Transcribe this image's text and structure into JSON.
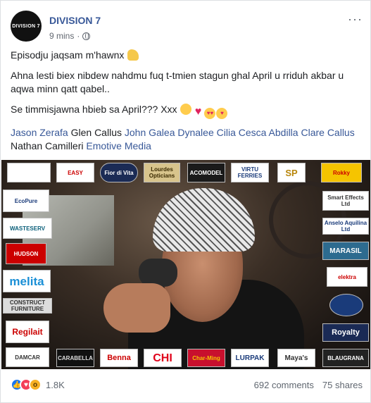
{
  "post": {
    "page_name": "DIVISION 7",
    "avatar_text": "DIVISION 7",
    "time": "9 mins",
    "dot": "·",
    "more": "···",
    "line1": "Episodju jaqsam m'hawnx",
    "line2": "Ahna lesti biex nibdew nahdmu fuq t-tmien stagun ghal April u rriduh akbar u aqwa minn qatt qabel..",
    "line3": "Se timmisjawna hbieb sa April??? Xxx",
    "tags": [
      {
        "text": "Jason Zerafa",
        "link": true
      },
      {
        "text": " Glen Callus ",
        "link": false
      },
      {
        "text": "John Galea",
        "link": true
      },
      {
        "text": " Dynalee Cilia ",
        "link": true
      },
      {
        "text": "Cesca Abdilla",
        "link": true
      },
      {
        "text": " Clare Callus",
        "link": true
      },
      {
        "text": " Nathan Camilleri ",
        "link": false
      },
      {
        "text": "Emotive Media",
        "link": true
      }
    ]
  },
  "sponsors": {
    "top": [
      "",
      "EASY",
      "Fior di Vita",
      "Lourdes Opticians",
      "ACOMODEL",
      "VIRTU FERRIES",
      "SP",
      "Rokky"
    ],
    "left": [
      "EcoPure",
      "WASTESERV",
      "HUDSON",
      "melita",
      "CONSTRUCT FURNITURE",
      "Regilait",
      "DAMCAR"
    ],
    "right": [
      "Smart Effects Ltd",
      "Anselo Aquilina Ltd",
      "MARASIL",
      "elektra",
      "",
      "Royalty",
      "BLAUGRANA"
    ],
    "bottom": [
      "CARABELLA",
      "Benna",
      "CHI",
      "Char-Ming",
      "LURPAK",
      "Maya's"
    ]
  },
  "footer": {
    "reaction_count": "1.8K",
    "comments": "692 comments",
    "shares": "75 shares"
  },
  "colors": {
    "link": "#385898",
    "like": "#1877f2",
    "love": "#f33e58",
    "wow": "#f7b125"
  }
}
